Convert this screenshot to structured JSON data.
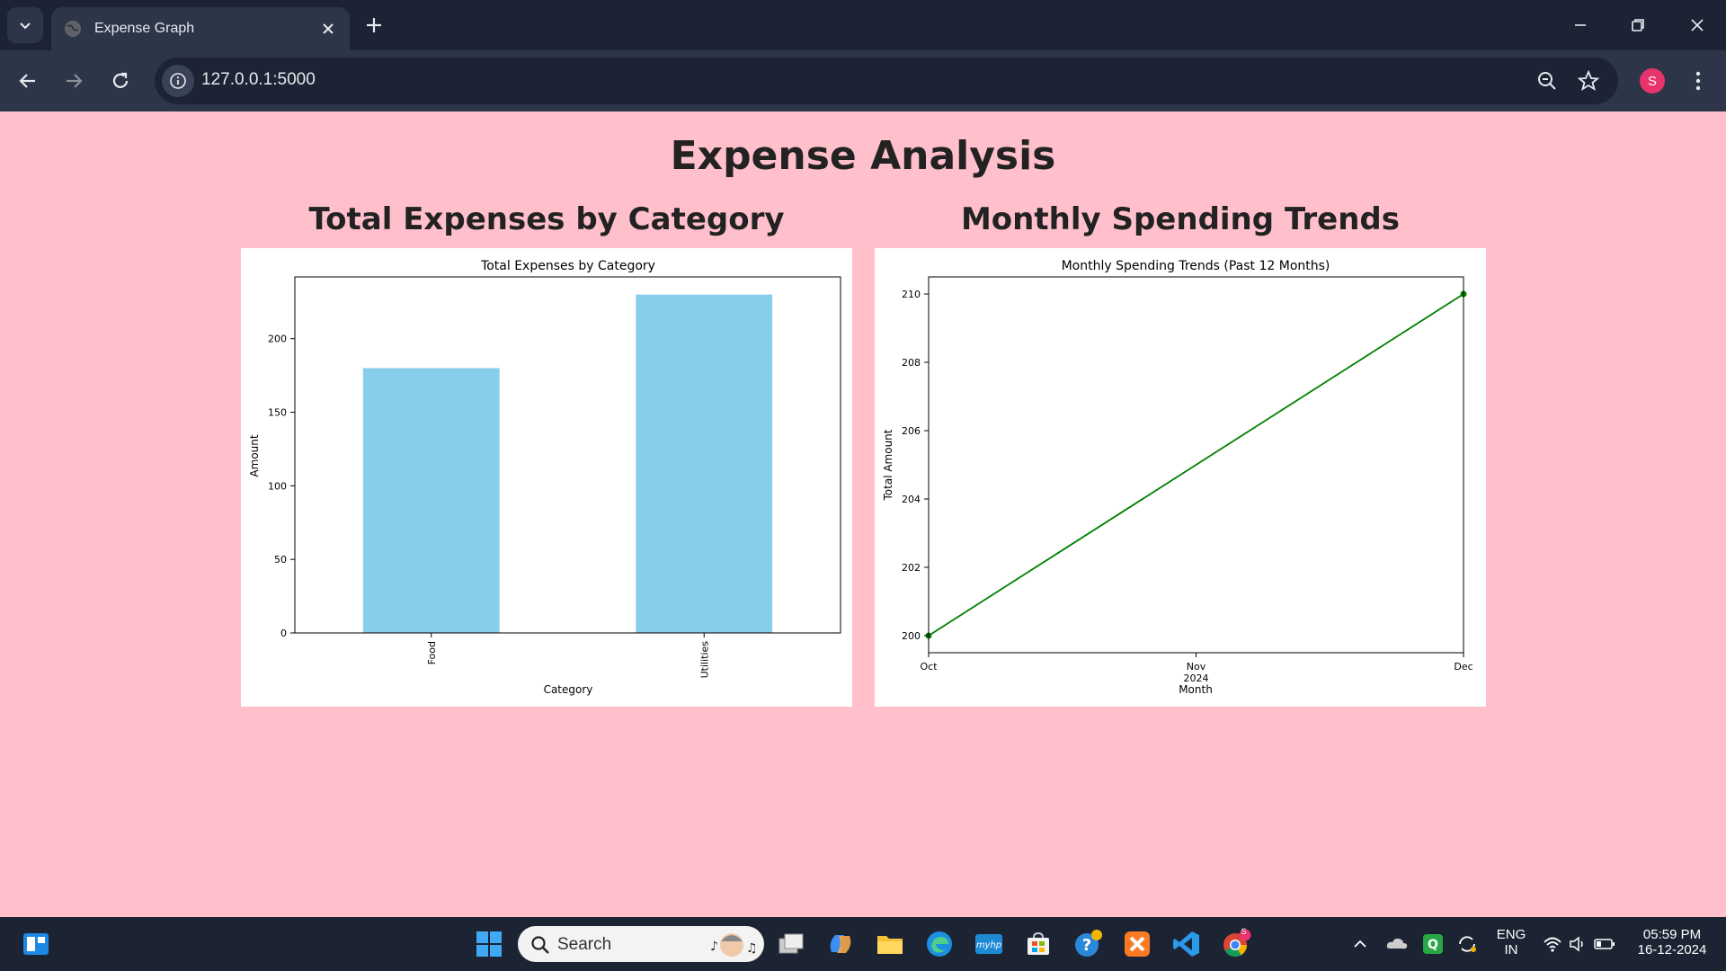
{
  "browser": {
    "tab_title": "Expense Graph",
    "url": "127.0.0.1:5000",
    "profile_initial": "S"
  },
  "page": {
    "title": "Expense Analysis",
    "section_left_title": "Total Expenses by Category",
    "section_right_title": "Monthly Spending Trends"
  },
  "chart_data": [
    {
      "type": "bar",
      "title": "Total Expenses by Category",
      "xlabel": "Category",
      "ylabel": "Amount",
      "categories": [
        "Food",
        "Utilities"
      ],
      "values": [
        180,
        230
      ],
      "ylim": [
        0,
        242
      ],
      "yticks": [
        0,
        50,
        100,
        150,
        200
      ],
      "bar_color": "#87ceeb",
      "grid": false
    },
    {
      "type": "line",
      "title": "Monthly Spending Trends (Past 12 Months)",
      "xlabel": "Month",
      "ylabel": "Total Amount",
      "x": [
        "2024-10",
        "2024-12"
      ],
      "y": [
        200,
        210
      ],
      "xticks": [
        "Oct",
        "Nov",
        "Dec"
      ],
      "xtick_sub": "2024",
      "ylim": [
        199.5,
        210.5
      ],
      "yticks": [
        200,
        202,
        204,
        206,
        208,
        210
      ],
      "line_color": "#008000",
      "grid": false
    }
  ],
  "taskbar": {
    "search_label": "Search",
    "lang_line1": "ENG",
    "lang_line2": "IN",
    "time": "05:59 PM",
    "date": "16-12-2024",
    "chrome_badge": "S"
  }
}
